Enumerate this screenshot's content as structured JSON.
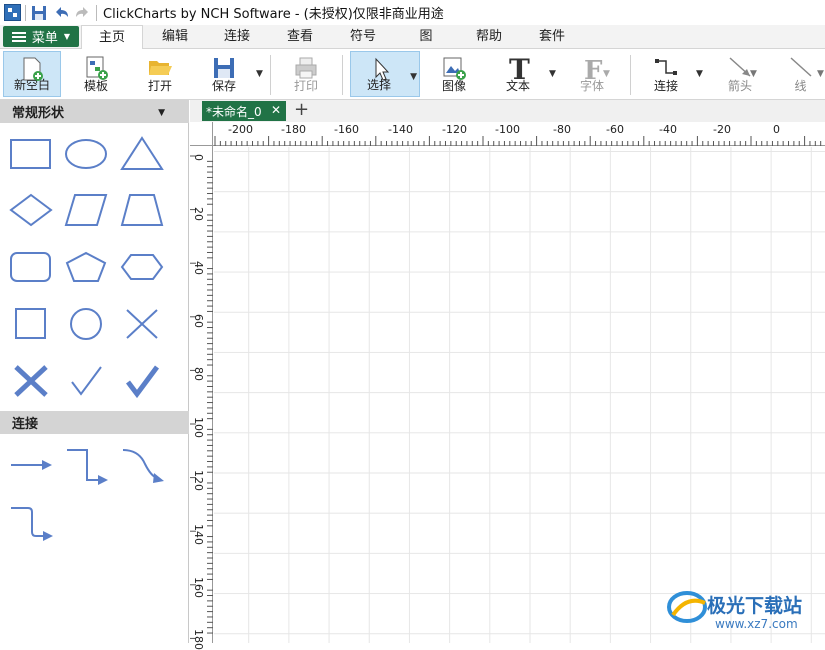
{
  "window": {
    "title": "ClickCharts by NCH Software - (未授权)仅限非商业用途"
  },
  "ribbon": {
    "menu_label": "菜单",
    "tabs": [
      "主页",
      "编辑",
      "连接",
      "查看",
      "符号",
      "图",
      "帮助",
      "套件"
    ],
    "active_tab": "主页"
  },
  "toolbar": {
    "new_blank": "新空白",
    "template": "模板",
    "open": "打开",
    "save": "保存",
    "print": "打印",
    "select": "选择",
    "image": "图像",
    "text": "文本",
    "font": "字体",
    "connect": "连接",
    "arrow": "箭头",
    "line": "线"
  },
  "sidebar": {
    "basic_shapes_title": "常规形状",
    "connectors_title": "连接",
    "basic_shapes": [
      "rectangle",
      "ellipse",
      "triangle",
      "diamond",
      "parallelogram",
      "trapezoid",
      "rounded-rectangle",
      "pentagon",
      "hexagon",
      "square",
      "circle",
      "cross-thin",
      "cross-thick",
      "check-thin",
      "check-thick"
    ],
    "connectors": [
      "straight-arrow",
      "elbow-arrow",
      "curved-arrow",
      "elbow-down-arrow"
    ]
  },
  "document": {
    "tab_title": "*未命名_0"
  },
  "rulers": {
    "horizontal": [
      "-200",
      "-180",
      "-160",
      "-140",
      "-120",
      "-100",
      "-80",
      "-60",
      "-40",
      "-20",
      "0"
    ],
    "vertical": [
      "0",
      "20",
      "40",
      "60",
      "80",
      "100",
      "120",
      "140",
      "160",
      "180"
    ]
  },
  "watermark": {
    "text": "极光下载站",
    "url": "www.xz7.com"
  },
  "colors": {
    "accent": "#217346",
    "shape_stroke": "#5b7fc8"
  }
}
